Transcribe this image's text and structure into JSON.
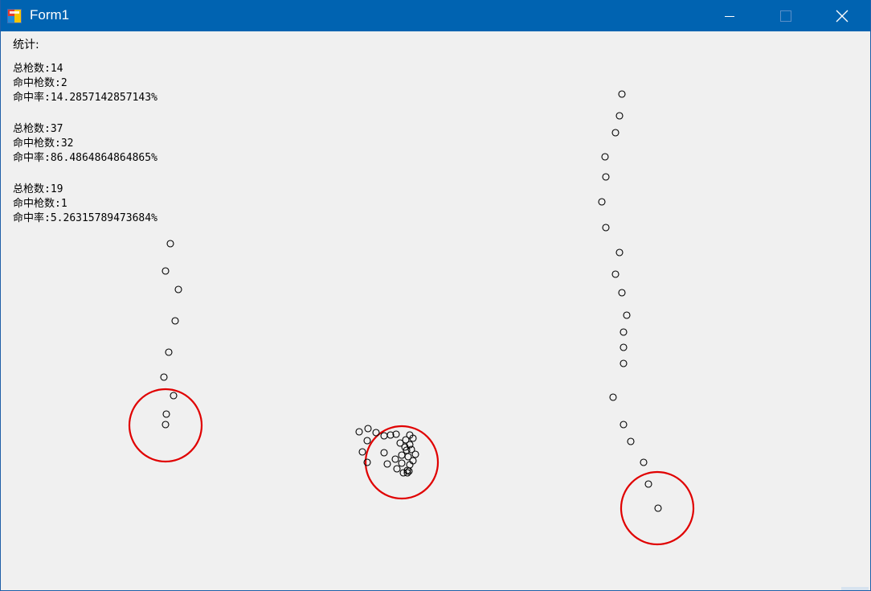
{
  "window": {
    "title": "Form1",
    "icon": "winforms-app-icon",
    "controls": [
      "minimize-icon",
      "maximize-icon",
      "close-icon"
    ]
  },
  "stats": {
    "heading": "统计:",
    "groups": [
      {
        "total_label": "总枪数",
        "total": "14",
        "hits_label": "命中枪数",
        "hits": "2",
        "rate_label": "命中率",
        "rate": "14.2857142857143%"
      },
      {
        "total_label": "总枪数",
        "total": "37",
        "hits_label": "命中枪数",
        "hits": "32",
        "rate_label": "命中率",
        "rate": "86.4864864864865%"
      },
      {
        "total_label": "总枪数",
        "total": "19",
        "hits_label": "命中枪数",
        "hits": "1",
        "rate_label": "命中率",
        "rate": "5.26315789473684%"
      }
    ]
  },
  "colors": {
    "titlebar": "#0063b1",
    "target_ring": "#e00000",
    "shot": "#000000",
    "background": "#f0f0f0"
  }
}
